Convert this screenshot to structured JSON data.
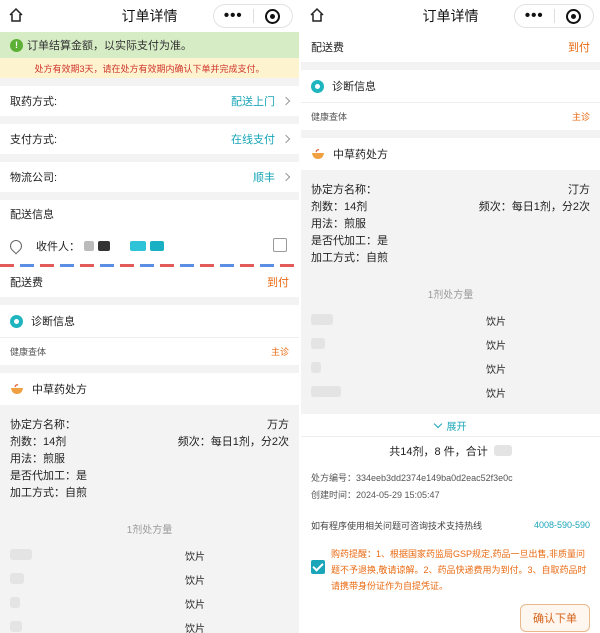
{
  "nav": {
    "title": "订单详情"
  },
  "notices": {
    "green": "订单结算金额，以实际支付为准。",
    "yellow": "处方有效期3天，请在处方有效期内确认下单并完成支付。"
  },
  "rows": {
    "pickup": {
      "label": "取药方式:",
      "value": "配送上门"
    },
    "payment": {
      "label": "支付方式:",
      "value": "在线支付"
    },
    "logistics": {
      "label": "物流公司:",
      "value": "顺丰"
    },
    "delivery_fee": {
      "label": "配送费",
      "value": "到付"
    }
  },
  "address": {
    "title": "配送信息",
    "receiver_label": "收件人："
  },
  "diagnosis": {
    "title": "诊断信息",
    "item": "健康查体",
    "tag": "主诊"
  },
  "prescription": {
    "title": "中草药处方",
    "name_label": "协定方名称：",
    "name_suffix": "万方",
    "name_suffix_right": "汀方",
    "doses": "剂数：14剂",
    "frequency": "频次：每日1剂，分2次",
    "usage": "用法：煎服",
    "processed": "是否代加工：是",
    "process_method": "加工方式：自煎",
    "dose_title": "1剂处方量",
    "herb_unit": "饮片",
    "expand": "展开",
    "total": "共14剂，8 件，合计"
  },
  "meta": {
    "rx_no": "处方编号：334eeb3dd2374e149ba0d2eac52f3e0c",
    "created": "创建时间：2024-05-29 15:05:47"
  },
  "hotline": {
    "label": "如有程序使用相关问题可咨询技术支持热线",
    "number": "4008-590-590"
  },
  "tips": "购药提醒：1、根据国家药监局GSP规定,药品一旦出售,非质量问题不予退换,敬请谅解。2、药品快递费用为到付。3、自取药品时请携带身份证作为自提凭证。",
  "confirm_label": "确认下单",
  "colors": {
    "accent": "#1aa5b8",
    "orange": "#e96a12",
    "notice_green": "#d6ecc5",
    "notice_yellow": "#fdf3cf"
  }
}
